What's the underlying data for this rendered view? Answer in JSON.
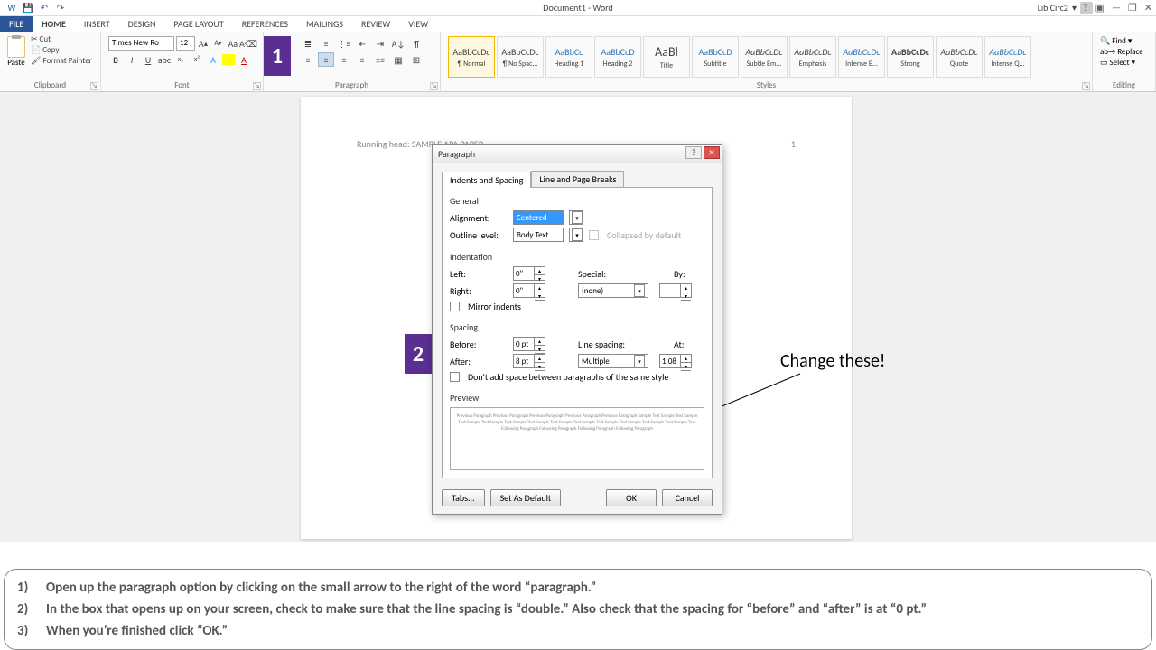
{
  "titlebar": {
    "doc_title": "Document1 - Word",
    "user": "Lib Circ2",
    "help": "?",
    "ribbon_opts": "▣",
    "minimize": "—",
    "restore": "❐",
    "close": "✕"
  },
  "tabs": [
    "FILE",
    "HOME",
    "INSERT",
    "DESIGN",
    "PAGE LAYOUT",
    "REFERENCES",
    "MAILINGS",
    "REVIEW",
    "VIEW"
  ],
  "ribbon": {
    "clipboard": {
      "label": "Clipboard",
      "paste": "Paste",
      "cut": "Cut",
      "copy": "Copy",
      "painter": "Format Painter"
    },
    "font": {
      "label": "Font",
      "name": "Times New Ro",
      "size": "12"
    },
    "paragraph": {
      "label": "Paragraph"
    },
    "styles": {
      "label": "Styles",
      "items": [
        {
          "preview": "AaBbCcDc",
          "name": "¶ Normal"
        },
        {
          "preview": "AaBbCcDc",
          "name": "¶ No Spac..."
        },
        {
          "preview": "AaBbCc",
          "name": "Heading 1",
          "cls": "blue"
        },
        {
          "preview": "AaBbCcD",
          "name": "Heading 2",
          "cls": "blue"
        },
        {
          "preview": "AaBl",
          "name": "Title",
          "cls": "big"
        },
        {
          "preview": "AaBbCcD",
          "name": "Subtitle",
          "cls": "blue"
        },
        {
          "preview": "AaBbCcDc",
          "name": "Subtle Em...",
          "cls": "italic"
        },
        {
          "preview": "AaBbCcDc",
          "name": "Emphasis",
          "cls": "italic"
        },
        {
          "preview": "AaBbCcDc",
          "name": "Intense E...",
          "cls": "italic blue"
        },
        {
          "preview": "AaBbCcDc",
          "name": "Strong",
          "cls": "bold"
        },
        {
          "preview": "AaBbCcDc",
          "name": "Quote",
          "cls": "italic"
        },
        {
          "preview": "AaBbCcDc",
          "name": "Intense Q...",
          "cls": "italic blue"
        }
      ]
    },
    "editing": {
      "label": "Editing",
      "find": "Find",
      "replace": "Replace",
      "select": "Select"
    }
  },
  "page": {
    "running_head": "Running head: SAMPLE APA PAPER",
    "page_num": "1"
  },
  "overlay": {
    "one": "1",
    "two": "2"
  },
  "dialog": {
    "title": "Paragraph",
    "tabs": [
      "Indents and Spacing",
      "Line and Page Breaks"
    ],
    "general": "General",
    "alignment_label": "Alignment:",
    "alignment_value": "Centered",
    "outline_label": "Outline level:",
    "outline_value": "Body Text",
    "collapsed": "Collapsed by default",
    "indentation": "Indentation",
    "left_label": "Left:",
    "left_value": "0\"",
    "right_label": "Right:",
    "right_value": "0\"",
    "special_label": "Special:",
    "special_value": "(none)",
    "by_label": "By:",
    "mirror": "Mirror indents",
    "spacing": "Spacing",
    "before_label": "Before:",
    "before_value": "0 pt",
    "after_label": "After:",
    "after_value": "8 pt",
    "linespacing_label": "Line spacing:",
    "linespacing_value": "Multiple",
    "at_label": "At:",
    "at_value": "1.08",
    "dontadd": "Don't add space between paragraphs of the same style",
    "preview": "Preview",
    "preview_text": "Previous Paragraph Previous Paragraph Previous Paragraph Previous Paragraph Previous Paragraph\nSample Text Sample Text Sample Text Sample Text Sample Text Sample Text Sample Text Sample Text\nSample Text Sample Text Sample Text Sample Text Sample Text\nFollowing Paragraph Following Paragraph Following Paragraph Following Paragraph",
    "tabs_btn": "Tabs...",
    "default_btn": "Set As Default",
    "ok": "OK",
    "cancel": "Cancel"
  },
  "annotation": "Change these!",
  "instructions": [
    "Open up the paragraph  option by clicking on the small arrow to the right of the word “paragraph.”",
    "In the box that opens up on your screen, check to make sure that the line spacing is “double.”  Also check that the spacing for “before” and “after” is at “0 pt.”",
    "When you’re finished click “OK.”"
  ]
}
